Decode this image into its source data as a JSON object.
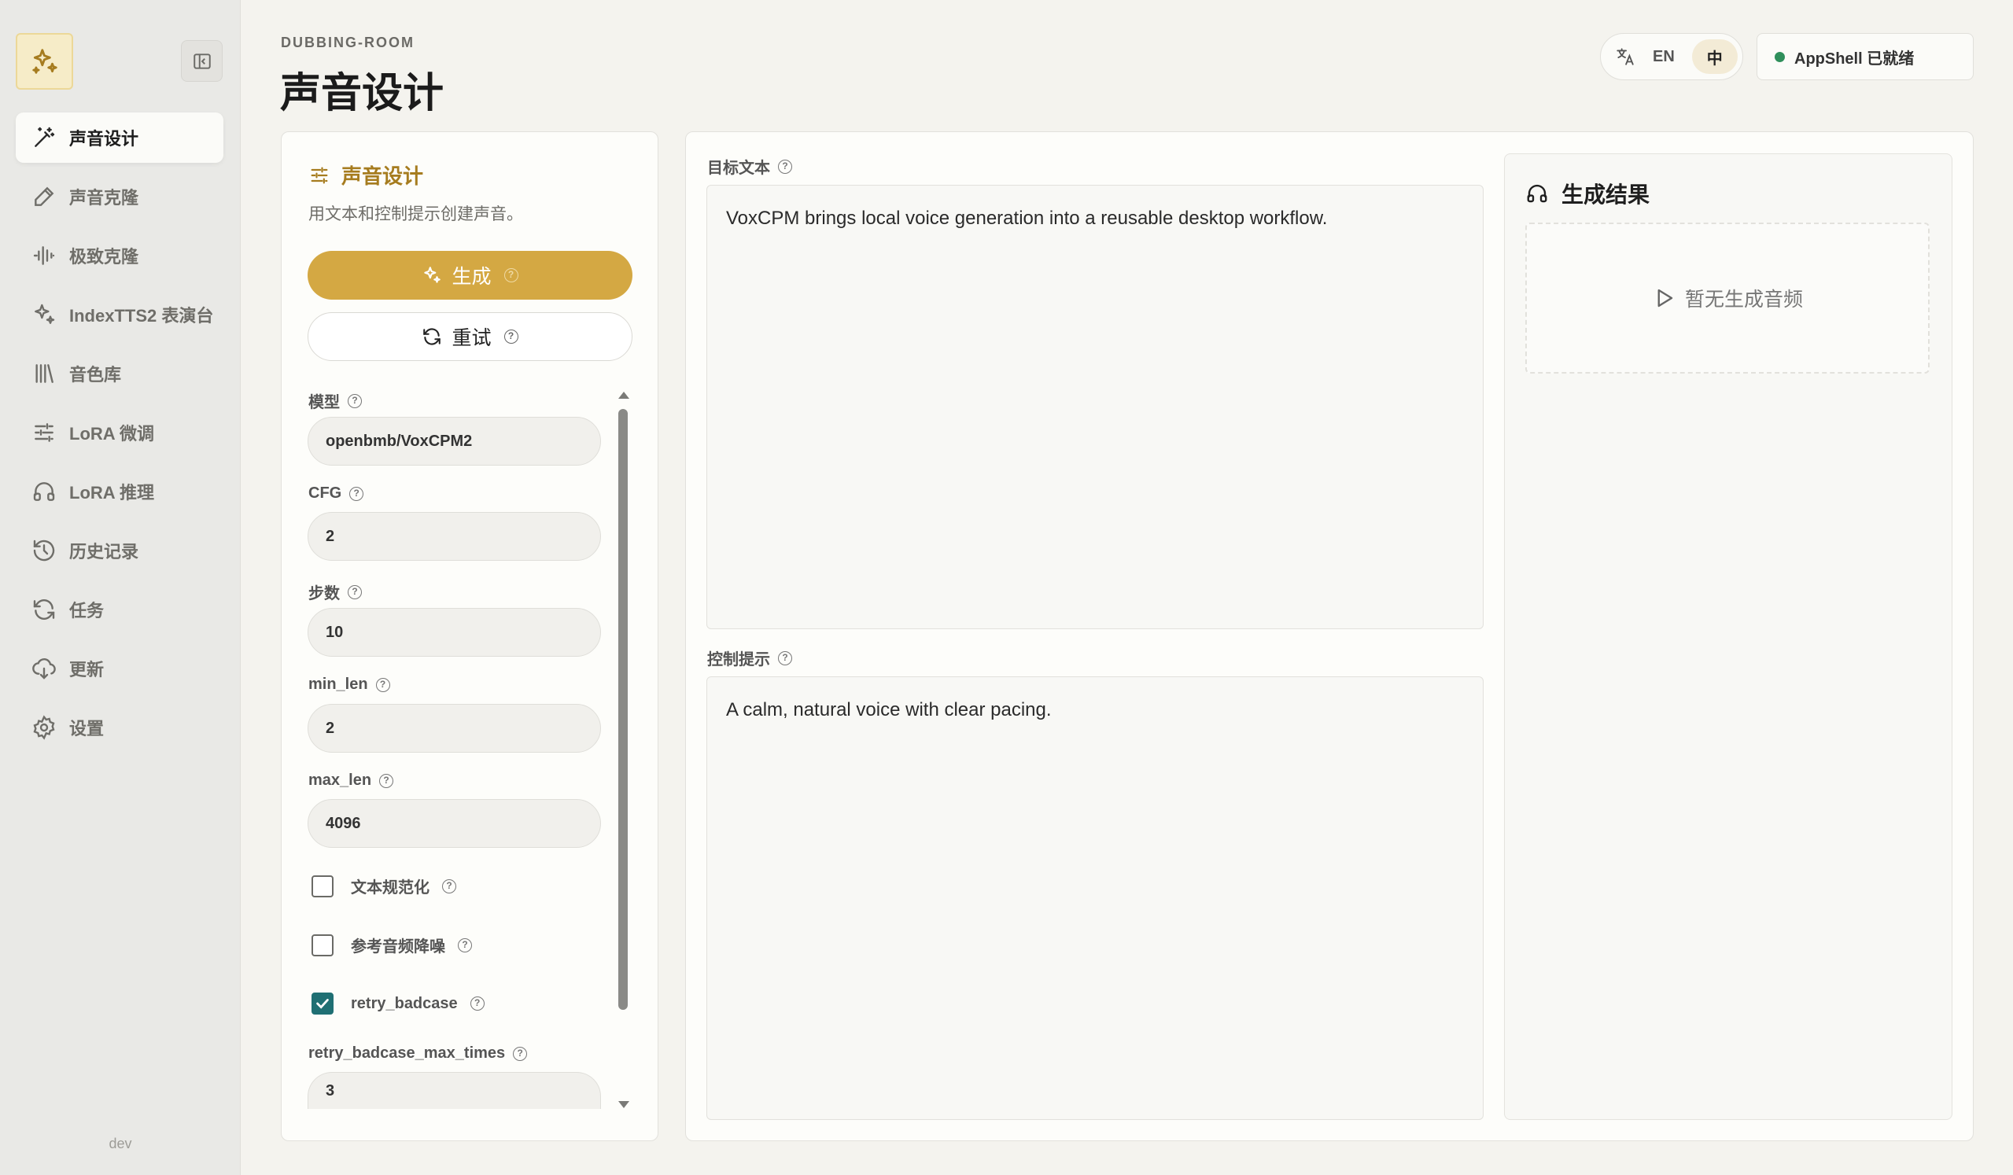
{
  "sidebar": {
    "items": [
      {
        "label": "声音设计",
        "icon": "wand-icon",
        "active": true
      },
      {
        "label": "声音克隆",
        "icon": "pen-icon"
      },
      {
        "label": "极致克隆",
        "icon": "waveform-icon"
      },
      {
        "label": "IndexTTS2 表演台",
        "icon": "sparkles-icon"
      },
      {
        "label": "音色库",
        "icon": "library-icon"
      },
      {
        "label": "LoRA 微调",
        "icon": "sliders-icon"
      },
      {
        "label": "LoRA 推理",
        "icon": "headphones-icon"
      },
      {
        "label": "历史记录",
        "icon": "history-icon"
      },
      {
        "label": "任务",
        "icon": "refresh-icon"
      },
      {
        "label": "更新",
        "icon": "cloud-download-icon"
      },
      {
        "label": "设置",
        "icon": "gear-icon"
      }
    ],
    "footer": "dev"
  },
  "header": {
    "breadcrumb": "DUBBING-ROOM",
    "title": "声音设计",
    "lang_en": "EN",
    "lang_zh": "中",
    "status": "AppShell 已就绪"
  },
  "left_panel": {
    "title": "声音设计",
    "description": "用文本和控制提示创建声音。",
    "generate_label": "生成",
    "retry_label": "重试",
    "fields": {
      "model_label": "模型",
      "model_value": "openbmb/VoxCPM2",
      "cfg_label": "CFG",
      "cfg_value": "2",
      "steps_label": "步数",
      "steps_value": "10",
      "min_len_label": "min_len",
      "min_len_value": "2",
      "max_len_label": "max_len",
      "max_len_value": "4096",
      "retry_max_label": "retry_badcase_max_times",
      "retry_max_value": "3"
    },
    "checks": {
      "normalize_label": "文本规范化",
      "normalize_checked": false,
      "denoise_label": "参考音频降噪",
      "denoise_checked": false,
      "retry_badcase_label": "retry_badcase",
      "retry_badcase_checked": true
    }
  },
  "main": {
    "target_text_label": "目标文本",
    "target_text": "VoxCPM brings local voice generation into a reusable desktop workflow.",
    "control_label": "控制提示",
    "control_text": "A calm, natural voice with clear pacing.",
    "result_title": "生成结果",
    "result_empty": "暂无生成音频"
  },
  "colors": {
    "accent": "#d4a843",
    "accent_text": "#a67c1f",
    "checkbox_on": "#1f6f73",
    "status_ok": "#2f8f5b"
  }
}
